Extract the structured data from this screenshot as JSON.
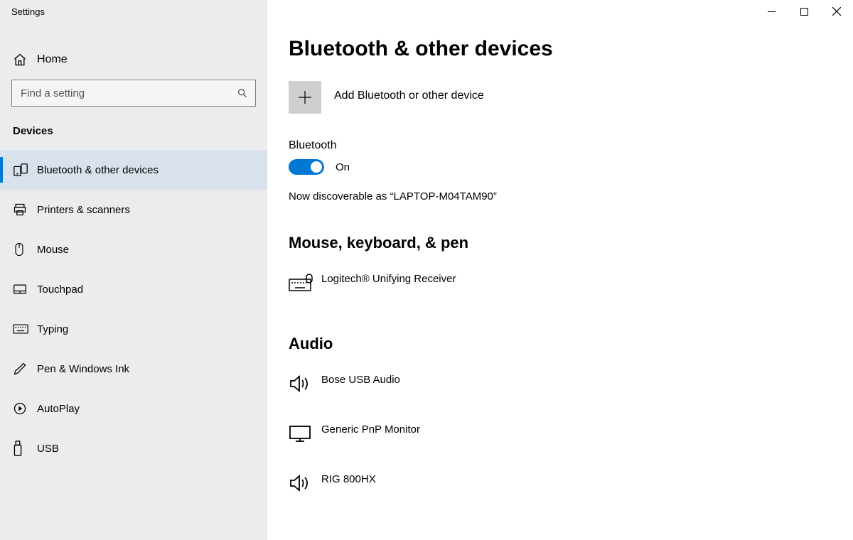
{
  "app": {
    "title": "Settings"
  },
  "sidebar": {
    "home_label": "Home",
    "search_placeholder": "Find a setting",
    "section_label": "Devices",
    "items": [
      {
        "label": "Bluetooth & other devices",
        "icon": "devices",
        "active": true
      },
      {
        "label": "Printers & scanners",
        "icon": "printer",
        "active": false
      },
      {
        "label": "Mouse",
        "icon": "mouse",
        "active": false
      },
      {
        "label": "Touchpad",
        "icon": "touchpad",
        "active": false
      },
      {
        "label": "Typing",
        "icon": "keyboard",
        "active": false
      },
      {
        "label": "Pen & Windows Ink",
        "icon": "pen",
        "active": false
      },
      {
        "label": "AutoPlay",
        "icon": "autoplay",
        "active": false
      },
      {
        "label": "USB",
        "icon": "usb",
        "active": false
      }
    ]
  },
  "main": {
    "page_title": "Bluetooth & other devices",
    "add_device_label": "Add Bluetooth or other device",
    "bluetooth_label": "Bluetooth",
    "bluetooth_state": "On",
    "discoverable_text": "Now discoverable as “LAPTOP-M04TAM90”",
    "groups": [
      {
        "heading": "Mouse, keyboard, & pen",
        "devices": [
          {
            "name": "Logitech® Unifying Receiver",
            "icon": "keyboard-mouse"
          }
        ]
      },
      {
        "heading": "Audio",
        "devices": [
          {
            "name": "Bose USB Audio",
            "icon": "speaker"
          },
          {
            "name": "Generic PnP Monitor",
            "icon": "monitor"
          },
          {
            "name": "RIG 800HX",
            "icon": "speaker"
          }
        ]
      }
    ]
  }
}
